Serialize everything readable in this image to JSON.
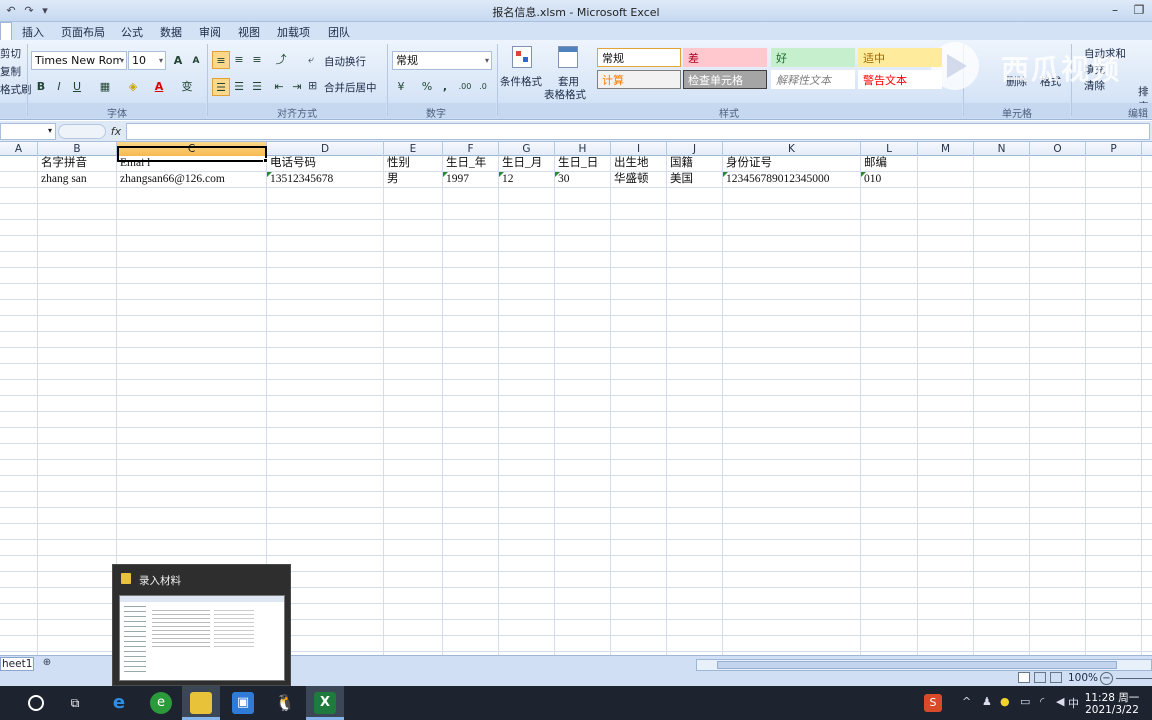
{
  "window": {
    "title": "报名信息.xlsm - Microsoft Excel",
    "min": "–",
    "restore": "❐",
    "close": "✕"
  },
  "tabs": [
    "插入",
    "页面布局",
    "公式",
    "数据",
    "审阅",
    "视图",
    "加载项",
    "团队"
  ],
  "ribbon": {
    "clipboard": {
      "cut": "剪切",
      "copy": "复制",
      "format_painter": "格式刷"
    },
    "font": {
      "name": "Times New Roman",
      "size": "10",
      "label": "字体",
      "grow": "A",
      "shrink": "A",
      "bold": "B",
      "italic": "I",
      "underline": "U",
      "color_letter": "A",
      "phonetic": "变"
    },
    "alignment": {
      "wrap": "自动换行",
      "merge": "合并后居中",
      "label": "对齐方式"
    },
    "number": {
      "format": "常规",
      "label": "数字",
      "percent": "%",
      "comma": ",",
      "inc": ".00",
      "dec": ".0"
    },
    "styles": {
      "cond_format": "条件格式",
      "table_format_1": "套用",
      "table_format_2": "表格格式",
      "label": "样式",
      "cells": [
        {
          "text": "常规",
          "bg": "#ffffff",
          "color": "#111111",
          "border": "#e3a33a"
        },
        {
          "text": "差",
          "bg": "#ffc7ce",
          "color": "#b00020",
          "border": "#ffc7ce"
        },
        {
          "text": "好",
          "bg": "#c6efce",
          "color": "#1a6b2a",
          "border": "#c6efce"
        },
        {
          "text": "适中",
          "bg": "#ffeb9c",
          "color": "#9c6500",
          "border": "#ffeb9c"
        },
        {
          "text": "计算",
          "bg": "#f2f2f2",
          "color": "#fa7d00",
          "border": "#7f7f7f"
        },
        {
          "text": "检查单元格",
          "bg": "#a5a5a5",
          "color": "#ffffff",
          "border": "#3f3f3f"
        },
        {
          "text": "解释性文本",
          "bg": "#ffffff",
          "color": "#7f7f7f",
          "border": "#ffffff"
        },
        {
          "text": "警告文本",
          "bg": "#ffffff",
          "color": "#ff0000",
          "border": "#ffffff"
        }
      ]
    },
    "cells_group": {
      "label": "单元格",
      "delete": "删除",
      "format": "格式"
    },
    "editing": {
      "label": "编辑",
      "autosum": "自动求和",
      "fill": "填充",
      "clear": "清除",
      "sort": "排序"
    }
  },
  "formula_bar": {
    "fx": "fx",
    "value": ""
  },
  "columns": [
    {
      "id": "A",
      "w": 38
    },
    {
      "id": "B",
      "w": 79
    },
    {
      "id": "C",
      "w": 150,
      "selected": true
    },
    {
      "id": "D",
      "w": 117
    },
    {
      "id": "E",
      "w": 59
    },
    {
      "id": "F",
      "w": 56
    },
    {
      "id": "G",
      "w": 56
    },
    {
      "id": "H",
      "w": 56
    },
    {
      "id": "I",
      "w": 56
    },
    {
      "id": "J",
      "w": 56
    },
    {
      "id": "K",
      "w": 138
    },
    {
      "id": "L",
      "w": 57
    },
    {
      "id": "M",
      "w": 56
    },
    {
      "id": "N",
      "w": 56
    },
    {
      "id": "O",
      "w": 56
    },
    {
      "id": "P",
      "w": 56
    }
  ],
  "rows": [
    [
      "",
      "名字拼音",
      "Emai l",
      "电话号码",
      "性别",
      "生日_年",
      "生日_月",
      "生日_日",
      "出生地",
      "国籍",
      "身份证号",
      "邮编"
    ],
    [
      "",
      "zhang san",
      "zhangsan66@126.com",
      "13512345678",
      "男",
      "1997",
      "12",
      "30",
      "华盛顿",
      "美国",
      "123456789012345000",
      "010"
    ]
  ],
  "text_number_markers": [
    "D2",
    "F2",
    "G2",
    "H2",
    "K2",
    "L2"
  ],
  "sheet_tab": "heet1",
  "status": {
    "zoom": "100%"
  },
  "popup": {
    "title": "录入材料"
  },
  "taskbar": {
    "time": "11:28 周一",
    "date": "2021/3/22",
    "ime": "中",
    "apps": [
      "search-icon",
      "task-view-icon",
      "edge-icon",
      "browser-icon",
      "file-explorer-icon",
      "teams-icon",
      "qq-icon",
      "excel-icon"
    ]
  },
  "watermark": {
    "text": "西瓜视频"
  }
}
